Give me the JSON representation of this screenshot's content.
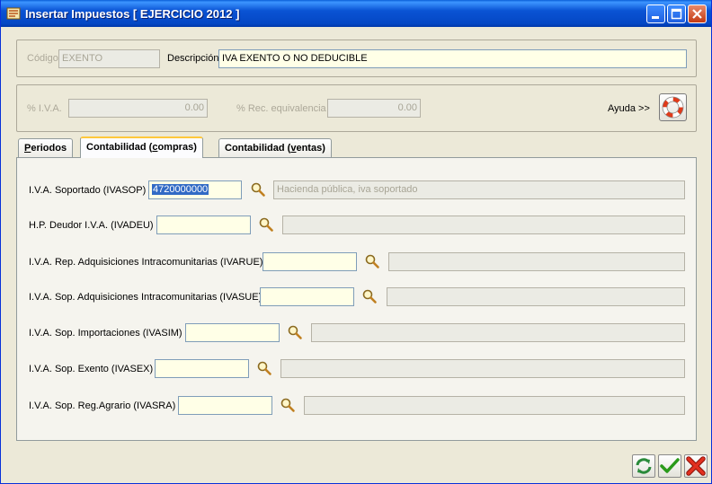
{
  "window": {
    "title": "Insertar Impuestos [ EJERCICIO 2012 ]"
  },
  "header": {
    "codigo_label": "Código",
    "codigo_value": "EXENTO",
    "descripcion_label": "Descripción",
    "descripcion_value": "IVA EXENTO O NO DEDUCIBLE"
  },
  "rates": {
    "iva_label": "% I.V.A.",
    "iva_value": "0.00",
    "rec_label": "% Rec. equivalencia",
    "rec_value": "0.00",
    "help_label": "Ayuda >>"
  },
  "tabs": [
    {
      "label_pre": "",
      "label_ul": "P",
      "label_post": "eriodos"
    },
    {
      "label_pre": "Contabilidad (",
      "label_ul": "c",
      "label_post": "ompras)"
    },
    {
      "label_pre": "Contabilidad (",
      "label_ul": "v",
      "label_post": "entas)"
    }
  ],
  "accounts": [
    {
      "label": "I.V.A. Soportado (IVASOP)",
      "value": "4720000000",
      "description": "Hacienda pública, iva soportado"
    },
    {
      "label": "H.P. Deudor I.V.A. (IVADEU)",
      "value": "",
      "description": ""
    },
    {
      "label": "I.V.A. Rep. Adquisiciones Intracomunitarias (IVARUE)",
      "value": "",
      "description": ""
    },
    {
      "label": "I.V.A. Sop. Adquisiciones Intracomunitarias (IVASUE)",
      "value": "",
      "description": ""
    },
    {
      "label": "I.V.A. Sop. Importaciones (IVASIM)",
      "value": "",
      "description": ""
    },
    {
      "label": "I.V.A. Sop. Exento (IVASEX)",
      "value": "",
      "description": ""
    },
    {
      "label": "I.V.A. Sop. Reg.Agrario (IVASRA)",
      "value": "",
      "description": ""
    }
  ],
  "colors": {
    "accept": "#2a9a1a",
    "cancel": "#d02418",
    "refresh": "#2a8a3a"
  }
}
